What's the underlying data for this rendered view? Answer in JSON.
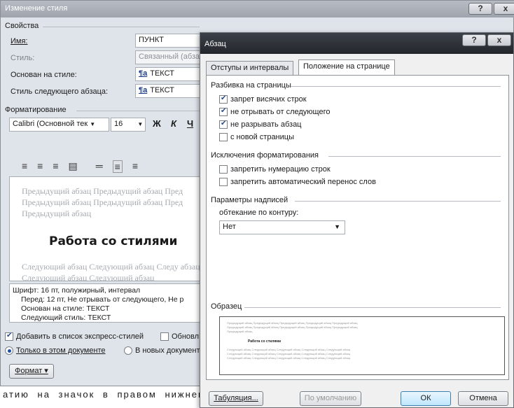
{
  "outer": {
    "title": "Изменение стиля",
    "help": "?",
    "close": "x",
    "properties_header": "Свойства",
    "name_label": "Имя:",
    "name_value": "ПУНКТ",
    "style_label": "Стиль:",
    "style_value": "Связанный (абзац",
    "based_label": "Основан на стиле:",
    "based_value": "ТЕКСТ",
    "next_label": "Стиль следующего абзаца:",
    "next_value": "ТЕКСТ",
    "para_glyph": "¶a",
    "format_header": "Форматирование",
    "font_name": "Calibri (Основной тек",
    "font_size": "16",
    "bold": "Ж",
    "italic": "К",
    "underline": "Ч",
    "preview_prev": "Предыдущий абзац Предыдущий абзац Пред Предыдущий абзац Предыдущий абзац Пред Предыдущий абзац",
    "preview_sample": "Работа со стилями",
    "preview_next": "Следующий абзац Следующий абзац Следу абзац Следующий абзац Следующий абзац",
    "desc_line1": "Шрифт: 16 пт, полужирный, интервал",
    "desc_line2": "Перед: 12 пт, Не отрывать от следующего, Не р",
    "desc_line3": "Основан на стиле: ТЕКСТ",
    "desc_line4": "Следующий стиль: ТЕКСТ",
    "add_quick": "Добавить в список экспресс-стилей",
    "auto_update": "Обновл",
    "only_doc": "Только в этом документе",
    "new_docs": "В новых документ",
    "format_btn": "Формат ▾"
  },
  "background_text": "атию на значок в правом нижнем",
  "para": {
    "title": "Абзац",
    "help": "?",
    "close": "x",
    "tab_indents": "Отступы и интервалы",
    "tab_position": "Положение на странице",
    "pagination_header": "Разбивка на страницы",
    "widow": "запрет висячих строк",
    "keep_next": "не отрывать от следующего",
    "keep_lines": "не разрывать абзац",
    "page_break": "с новой страницы",
    "exceptions_header": "Исключения форматирования",
    "suppress_numbers": "запретить нумерацию строк",
    "no_hyphen": "запретить автоматический перенос слов",
    "textbox_header": "Параметры надписей",
    "wrap_label": "обтекание по контуру:",
    "wrap_value": "Нет",
    "sample_header": "Образец",
    "sample_prev": "Предыдущий абзац Предыдущий абзац Предыдущий абзац Предыдущий абзац Предыдущий абзац",
    "sample_prev2": "Предыдущий абзац Предыдущий абзац Предыдущий абзац Предыдущий абзац Предыдущий абзац",
    "sample_prev3": "Предыдущий абзац",
    "sample_main": "Работа со стилями",
    "sample_next": "Следующий абзац Следующий абзац Следующий абзац Следующий абзац Следующий абзац",
    "sample_next2": "Следующий абзац Следующий абзац Следующий абзац Следующий абзац Следующий абзац",
    "sample_next3": "Следующий абзац Следующий абзац Следующий абзац Следующий абзац Следующий абзац",
    "tabs_btn": "Табуляция...",
    "default_btn": "По умолчанию",
    "ok_btn": "ОК",
    "cancel_btn": "Отмена"
  }
}
